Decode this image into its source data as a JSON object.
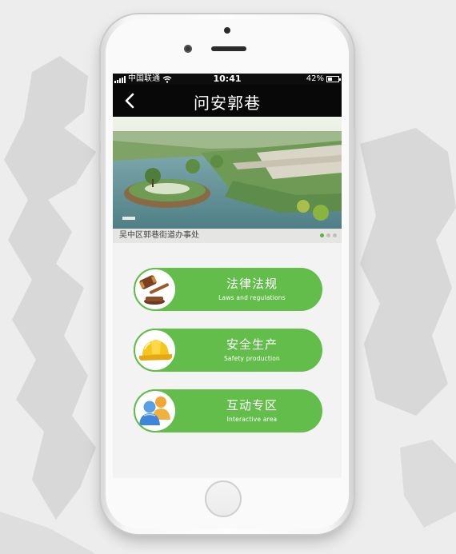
{
  "status_bar": {
    "carrier": "中国联通",
    "time": "10:41",
    "battery": "42%",
    "battery_level": 0.42
  },
  "nav": {
    "title": "问安郭巷",
    "back_icon": "chevron-left-icon"
  },
  "banner": {
    "caption": "吴中区郭巷街道办事处",
    "slide_count": 3,
    "active_slide": 0
  },
  "menu": [
    {
      "label": "法律法规",
      "sublabel": "Laws and regulations",
      "icon": "gavel-icon"
    },
    {
      "label": "安全生产",
      "sublabel": "Safety production",
      "icon": "hard-hat-icon"
    },
    {
      "label": "互动专区",
      "sublabel": "Interactive area",
      "icon": "users-icon"
    }
  ],
  "colors": {
    "accent_green": "#63bd4a",
    "nav_background": "#080808",
    "active_dot": "#59b43e"
  }
}
